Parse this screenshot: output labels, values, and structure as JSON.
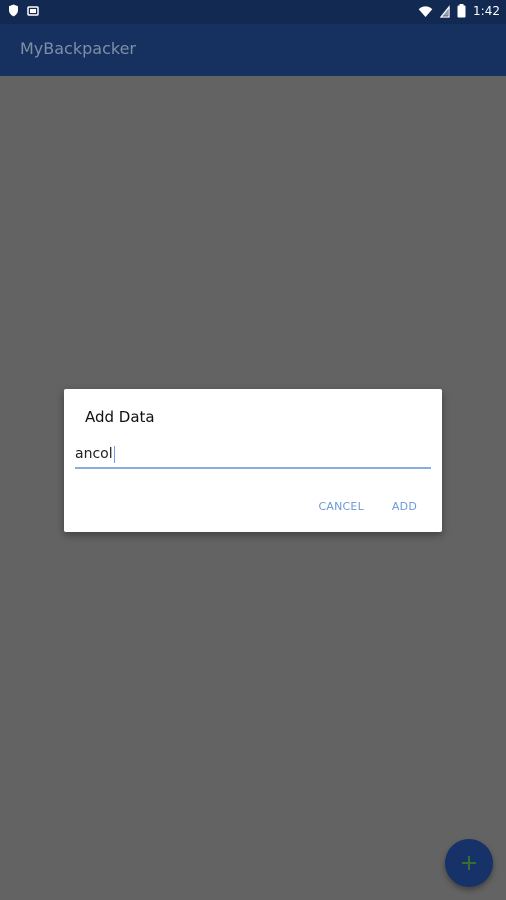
{
  "status_bar": {
    "time": "1:42",
    "icons": [
      "shield-icon",
      "screenshot-icon",
      "wifi-icon",
      "signal-icon",
      "battery-icon"
    ]
  },
  "app_bar": {
    "title": "MyBackpacker",
    "color": "#16305f"
  },
  "dialog": {
    "title": "Add Data",
    "input_value": "ancol",
    "actions": {
      "cancel_label": "CANCEL",
      "add_label": "ADD"
    },
    "accent_color": "#6b98d7"
  },
  "fab": {
    "icon": "plus-icon",
    "color": "#173268"
  },
  "colors": {
    "scrim": "#636363",
    "status_bar": "#122a52"
  }
}
